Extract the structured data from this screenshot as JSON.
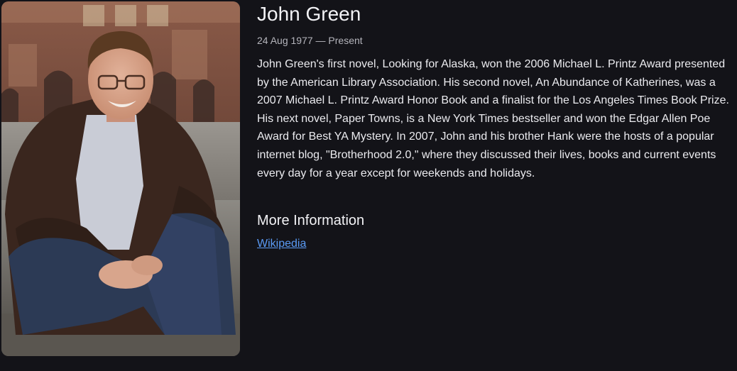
{
  "author": {
    "name": "John Green",
    "dates": "24 Aug 1977 — Present",
    "bio": "John Green's first novel, Looking for Alaska, won the 2006 Michael L. Printz Award presented by the American Library Association. His second novel, An Abundance of Katherines, was a 2007 Michael L. Printz Award Honor Book and a finalist for the Los Angeles Times Book Prize. His next novel, Paper Towns, is a New York Times bestseller and won the Edgar Allen Poe Award for Best YA Mystery. In 2007, John and his brother Hank were the hosts of a popular internet blog, \"Brotherhood 2.0,\" where they discussed their lives, books and current events every day for a year except for weekends and holidays."
  },
  "more_info": {
    "heading": "More Information",
    "links": [
      {
        "label": "Wikipedia"
      }
    ]
  },
  "colors": {
    "background": "#131318",
    "link": "#5b9bf5"
  }
}
